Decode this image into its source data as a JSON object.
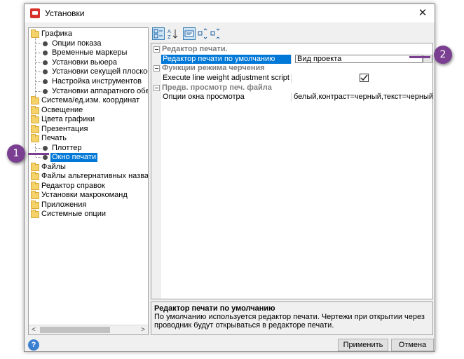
{
  "window": {
    "title": "Установки",
    "close_glyph": "✕"
  },
  "tree": {
    "items": [
      {
        "label": "Графика"
      },
      {
        "label": "Опции показа"
      },
      {
        "label": "Временные маркеры"
      },
      {
        "label": "Установки вьюера"
      },
      {
        "label": "Установки секущей плоскости"
      },
      {
        "label": "Настройка инструментов"
      },
      {
        "label": "Установки аппаратного обеспеч"
      },
      {
        "label": "Система/ед.изм. координат"
      },
      {
        "label": "Освещение"
      },
      {
        "label": "Цвета графики"
      },
      {
        "label": "Презентация"
      },
      {
        "label": "Печать"
      },
      {
        "label": "Плоттер"
      },
      {
        "label": "Окно печати"
      },
      {
        "label": "Файлы"
      },
      {
        "label": "Файлы альтернативных названий"
      },
      {
        "label": "Редактор справок"
      },
      {
        "label": "Установки макрокоманд"
      },
      {
        "label": "Приложения"
      },
      {
        "label": "Системные опции"
      }
    ],
    "selected": "Окно печати"
  },
  "properties": {
    "categories": [
      {
        "label": "Редактор печати.",
        "rows": [
          {
            "name": "Редактор печати по умолчанию",
            "value": "Вид проекта"
          }
        ]
      },
      {
        "label": "Функции режима черчения",
        "rows": [
          {
            "name": "Execute line weight adjustment script",
            "value": ""
          }
        ]
      },
      {
        "label": "Предв. просмотр печ. файла",
        "rows": [
          {
            "name": "Опции окна просмотра",
            "value": "белый,контраст=черный,текст=черный"
          }
        ]
      }
    ]
  },
  "description": {
    "title": "Редактор печати по умолчанию",
    "text": "По умолчанию используется редактор печати. Чертежи при открытии через проводник будут открываться в редакторе печати."
  },
  "buttons": {
    "apply": "Применить",
    "cancel": "Отмена",
    "help": "?"
  },
  "callouts": {
    "one": "1",
    "two": "2"
  },
  "icons": {
    "scroll_left": "<",
    "scroll_right": ">",
    "checkmark": "✓",
    "dropdown": "▾"
  },
  "colors": {
    "selection": "#0078d7",
    "callout": "#7a3f91"
  }
}
